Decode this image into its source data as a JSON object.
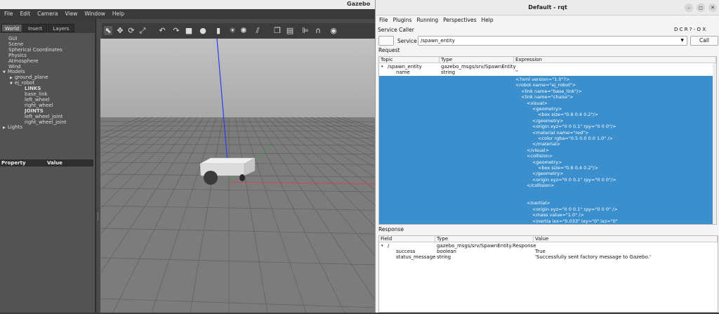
{
  "gazebo": {
    "title": "Gazebo",
    "menu": [
      "File",
      "Edit",
      "Camera",
      "View",
      "Window",
      "Help"
    ],
    "tabs": [
      "World",
      "Insert",
      "Layers"
    ],
    "tree": [
      {
        "label": "GUI",
        "indent": 0,
        "arrow": ""
      },
      {
        "label": "Scene",
        "indent": 0,
        "arrow": ""
      },
      {
        "label": "Spherical Coordinates",
        "indent": 0,
        "arrow": ""
      },
      {
        "label": "Physics",
        "indent": 0,
        "arrow": ""
      },
      {
        "label": "Atmosphere",
        "indent": 0,
        "arrow": ""
      },
      {
        "label": "Wind",
        "indent": 0,
        "arrow": ""
      },
      {
        "label": "Models",
        "indent": -1,
        "arrow": "▼"
      },
      {
        "label": "ground_plane",
        "indent": 1,
        "arrow": "▶"
      },
      {
        "label": "ej_robot",
        "indent": 1,
        "arrow": "▼"
      },
      {
        "label": "LINKS",
        "indent": 2,
        "arrow": "",
        "bold": true
      },
      {
        "label": "base_link",
        "indent": 2,
        "arrow": ""
      },
      {
        "label": "left_wheel",
        "indent": 2,
        "arrow": ""
      },
      {
        "label": "right_wheel",
        "indent": 2,
        "arrow": ""
      },
      {
        "label": "JOINTS",
        "indent": 2,
        "arrow": "",
        "bold": true
      },
      {
        "label": "left_wheel_joint",
        "indent": 2,
        "arrow": ""
      },
      {
        "label": "right_wheel_joint",
        "indent": 2,
        "arrow": ""
      },
      {
        "label": "Lights",
        "indent": -1,
        "arrow": "▶"
      }
    ],
    "property_header": {
      "property": "Property",
      "value": "Value"
    },
    "toolbar_icons": [
      "select-icon",
      "translate-icon",
      "rotate-icon",
      "scale-icon",
      "undo-icon",
      "redo-icon",
      "box-icon",
      "sphere-icon",
      "cylinder-icon",
      "light-point-icon",
      "light-spot-icon",
      "light-directional-icon",
      "copy-icon",
      "paste-icon",
      "align-icon",
      "snap-icon",
      "screenshot-icon"
    ],
    "colors": {
      "sky": "#b9b9b9",
      "ground": "#7c7c7c",
      "grid": "#5e5e5e",
      "z_axis": "#2c3de6",
      "x_axis": "#e04040",
      "y_axis": "#40a040"
    }
  },
  "rqt": {
    "title": "Default - rqt",
    "window_buttons": [
      "–",
      "◻",
      "✕"
    ],
    "menu": [
      "File",
      "Plugins",
      "Running",
      "Perspectives",
      "Help"
    ],
    "plugin_title": "Service Caller",
    "plugin_controls": "D C R ?  -  O X",
    "service_label": "Service",
    "service_value": "/spawn_entity",
    "call_label": "Call",
    "request_label": "Request",
    "request_columns": [
      "Topic",
      "Type",
      "Expression"
    ],
    "request_rows": [
      {
        "topic": "/spawn_entity",
        "type": "gazebo_msgs/srv/SpawnEntity",
        "expr": "",
        "arrow": "▾"
      },
      {
        "topic": "name",
        "type": "string",
        "expr": "''",
        "arrow": ""
      }
    ],
    "xml_lines": [
      {
        "text": "<?xml version=\"1.0\"?>",
        "indent": 0
      },
      {
        "text": "<robot name=\"ej_robot\">",
        "indent": 0
      },
      {
        "text": "<link name=\"base_link\"/>",
        "indent": 1
      },
      {
        "text": "<link name=\"chaiss\">",
        "indent": 1
      },
      {
        "text": "<visual>",
        "indent": 2
      },
      {
        "text": "<geometry>",
        "indent": 3
      },
      {
        "text": "<box size=\"0.6 0.4 0.2\"/>",
        "indent": 4
      },
      {
        "text": "</geometry>",
        "indent": 3
      },
      {
        "text": "<origin xyz=\"0 0 0.1\" rpy=\"0 0 0\"/>",
        "indent": 3
      },
      {
        "text": "<material name=\"red\">",
        "indent": 3
      },
      {
        "text": "<color rgba=\"0.5 0.0 0.0 1.0\" />",
        "indent": 4
      },
      {
        "text": "</material>",
        "indent": 3
      },
      {
        "text": "</visual>",
        "indent": 2
      },
      {
        "text": "<collision>",
        "indent": 2
      },
      {
        "text": "<geometry>",
        "indent": 3
      },
      {
        "text": "<box size=\"0.6 0.4 0.2\"/>",
        "indent": 4
      },
      {
        "text": "</geometry>",
        "indent": 3
      },
      {
        "text": "<origin xyz=\"0 0 0.1\" rpy=\"0 0 0\"/>",
        "indent": 3
      },
      {
        "text": "</collision>",
        "indent": 2
      },
      {
        "text": "",
        "indent": 0
      },
      {
        "text": "",
        "indent": 0
      },
      {
        "text": "<inertial>",
        "indent": 2
      },
      {
        "text": "<origin xyz=\"0 0 0.1\" rpy=\"0 0 0\" />",
        "indent": 3
      },
      {
        "text": "<mass value=\"1.0\" />",
        "indent": 3
      },
      {
        "text": "<inertia ixx=\"0.033\" ixy=\"0\" ixz=\"0\"",
        "indent": 3
      }
    ],
    "response_label": "Response",
    "response_columns": [
      "Field",
      "Type",
      "Value"
    ],
    "response_rows": [
      {
        "field": "/",
        "type": "gazebo_msgs/srv/SpawnEntity.Response",
        "value": "",
        "arrow": "▾"
      },
      {
        "field": "success",
        "type": "boolean",
        "value": "True",
        "arrow": ""
      },
      {
        "field": "status_message",
        "type": "string",
        "value": "'Successfully sent factory message to Gazebo.'",
        "arrow": ""
      }
    ],
    "colors": {
      "selection": "#3b8fcd"
    }
  }
}
